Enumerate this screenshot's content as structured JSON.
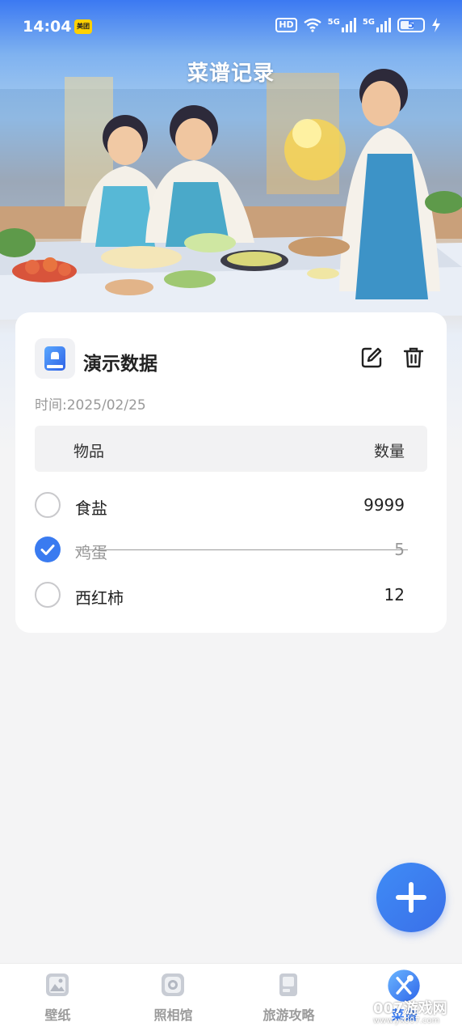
{
  "status_bar": {
    "time": "14:04",
    "app_badge": "美团",
    "hd": "HD",
    "net1": "5G",
    "net2": "5G",
    "battery": "5"
  },
  "header": {
    "title": "菜谱记录"
  },
  "record": {
    "title": "演示数据",
    "time_label": "时间:",
    "time_value": "2025/02/25",
    "columns": {
      "item": "物品",
      "quantity": "数量"
    },
    "items": [
      {
        "name": "食盐",
        "quantity": "9999",
        "checked": false
      },
      {
        "name": "鸡蛋",
        "quantity": "5",
        "checked": true
      },
      {
        "name": "西红柿",
        "quantity": "12",
        "checked": false
      }
    ]
  },
  "tabs": [
    {
      "label": "壁纸",
      "icon": "wallpaper-icon",
      "active": false
    },
    {
      "label": "照相馆",
      "icon": "camera-icon",
      "active": false
    },
    {
      "label": "旅游攻略",
      "icon": "travel-guide-icon",
      "active": false
    },
    {
      "label": "菜谱",
      "icon": "recipe-icon",
      "active": true
    }
  ],
  "watermark": {
    "line1": "007游戏网",
    "line2": "www.yx007.com"
  },
  "colors": {
    "accent": "#3a7bf0",
    "background": "#f4f4f5"
  }
}
